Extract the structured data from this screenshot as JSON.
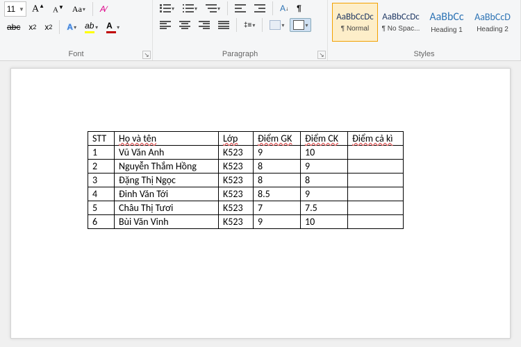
{
  "ribbon": {
    "font": {
      "size": "11",
      "label": "Font"
    },
    "paragraph": {
      "label": "Paragraph"
    },
    "styles": {
      "label": "Styles",
      "sample": "AaBbCcDc",
      "sample_heading": "AaBbCc",
      "sample_heading2": "AaBbCcD",
      "items": [
        {
          "name": "¶ Normal",
          "selected": true
        },
        {
          "name": "¶ No Spac..."
        },
        {
          "name": "Heading 1"
        },
        {
          "name": "Heading 2"
        }
      ]
    }
  },
  "table": {
    "headers": {
      "stt": "STT",
      "hoten": "Họ và tên",
      "lop": "Lớp",
      "gk": "Điểm GK",
      "ck": "Điểm CK",
      "caki": "Điểm cả kì"
    },
    "rows": [
      {
        "stt": "1",
        "name": "Vũ Văn Anh",
        "lop": "K523",
        "gk": "9",
        "ck": "10",
        "caki": ""
      },
      {
        "stt": "2",
        "name": "Nguyễn Thắm Hồng",
        "lop": "K523",
        "gk": "8",
        "ck": "9",
        "caki": ""
      },
      {
        "stt": "3",
        "name": "Đặng Thị Ngọc",
        "lop": "K523",
        "gk": "8",
        "ck": "8",
        "caki": ""
      },
      {
        "stt": "4",
        "name": "Đinh Văn Tới",
        "lop": "K523",
        "gk": "8.5",
        "ck": "9",
        "caki": ""
      },
      {
        "stt": "5",
        "name": "Châu Thị Tươi",
        "lop": "K523",
        "gk": "7",
        "ck": "7.5",
        "caki": ""
      },
      {
        "stt": "6",
        "name": "Bùi Văn Vinh",
        "lop": "K523",
        "gk": "9",
        "ck": "10",
        "caki": ""
      }
    ]
  }
}
